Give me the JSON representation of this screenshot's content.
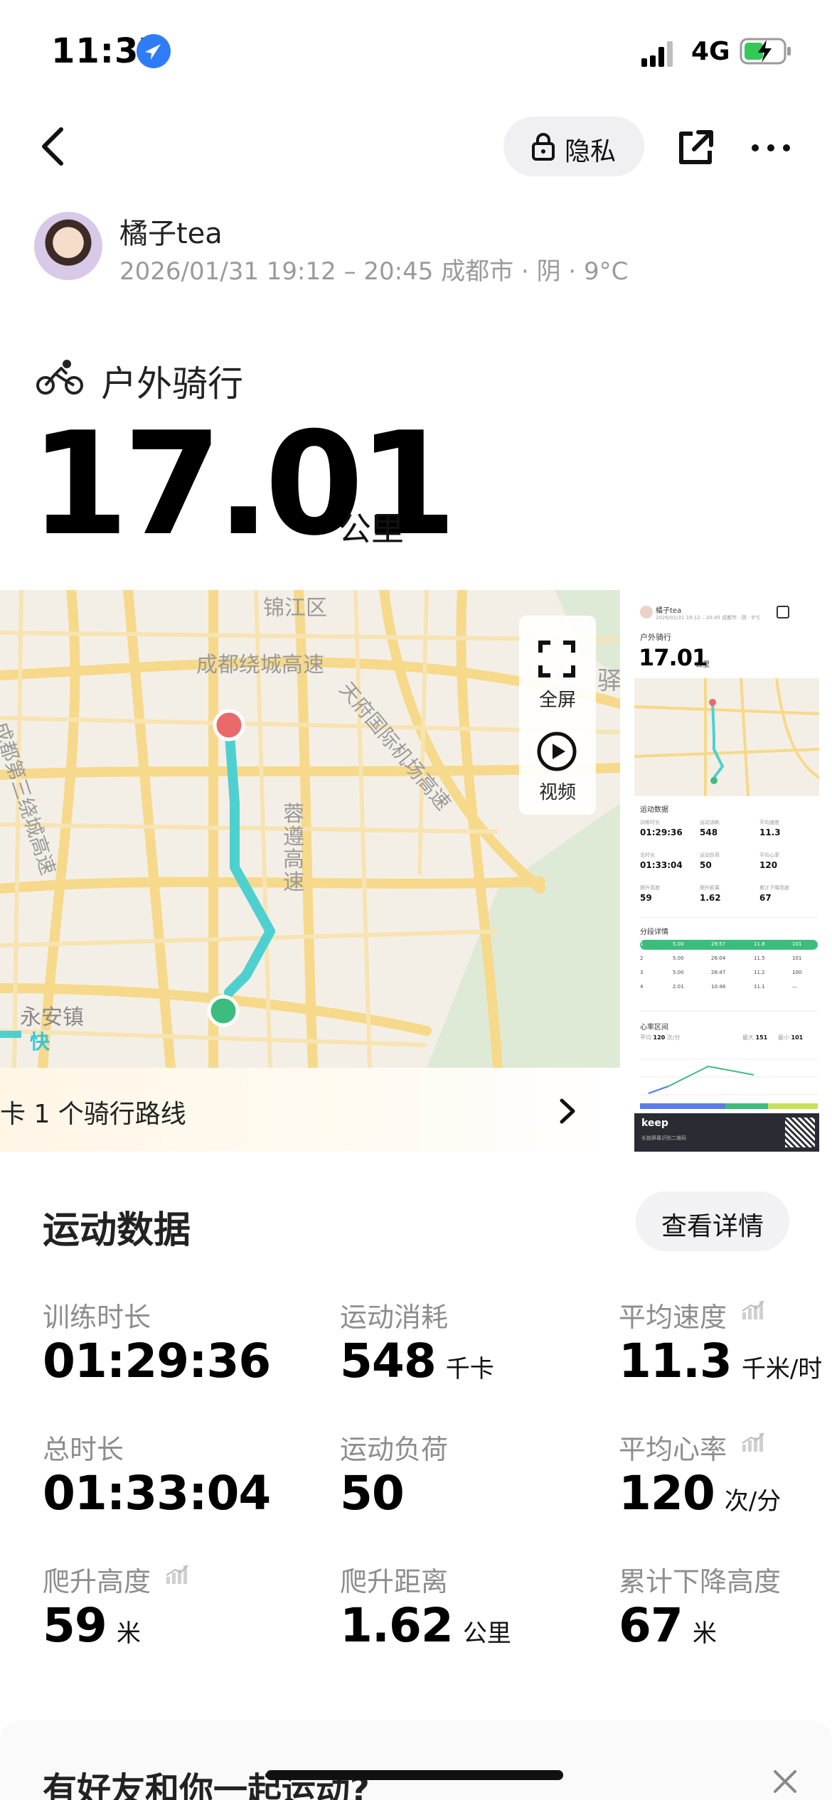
{
  "status_bar": {
    "time": "11:37",
    "network": "4G"
  },
  "nav": {
    "privacy_label": "隐私"
  },
  "user": {
    "name": "橘子tea",
    "meta": "2026/01/31 19:12 – 20:45 成都市 · 阴 · 9°C"
  },
  "activity": {
    "type": "户外骑行",
    "distance": "17.01",
    "distance_unit": "公里"
  },
  "map": {
    "labels": {
      "jinjiang": "锦江区",
      "ring_highway": "成都绕城高速",
      "third_ring": "成都第三绕城高速",
      "tianfu": "天府国际机场高速",
      "rongzun": "蓉遵高速",
      "yi": "驿",
      "town": "永安镇",
      "fast": "快"
    },
    "fullscreen_label": "全屏",
    "video_label": "视频",
    "route_banner": "卡 1 个骑行路线",
    "route_color": "#4fd0d0",
    "start_color": "#3dbd7d",
    "end_color": "#e96a6a"
  },
  "thumbnail": {
    "user": "橘子tea",
    "meta": "2026/01/31 19:12 – 20:45 成都市 · 阴 · 9°C",
    "activity": "户外骑行",
    "distance": "17.01",
    "unit": "公里",
    "section_stats": "运动数据",
    "stats": [
      {
        "label": "训练时长",
        "value": "01:29:36"
      },
      {
        "label": "运动消耗",
        "value": "548"
      },
      {
        "label": "平均速度",
        "value": "11.3"
      },
      {
        "label": "总时长",
        "value": "01:33:04"
      },
      {
        "label": "运动负荷",
        "value": "50"
      },
      {
        "label": "平均心率",
        "value": "120"
      },
      {
        "label": "爬升高度",
        "value": "59"
      },
      {
        "label": "爬升距离",
        "value": "1.62"
      },
      {
        "label": "累计下降高度",
        "value": "67"
      }
    ],
    "section_split": "分段详情",
    "split_rows": [
      [
        "1",
        "5.00",
        "29:57",
        "11.8",
        "101"
      ],
      [
        "2",
        "5.00",
        "26:04",
        "11.5",
        "101"
      ],
      [
        "3",
        "5.00",
        "26:47",
        "11.2",
        "100"
      ],
      [
        "4",
        "2.01",
        "10:48",
        "11.1",
        "—"
      ]
    ],
    "section_hr": "心率区间",
    "hr_avg": "120",
    "hr_max": "151",
    "hr_min": "101",
    "brand": "keep",
    "brand_sub": "长按屏幕识别二维码"
  },
  "stats": {
    "title": "运动数据",
    "detail_button": "查看详情",
    "items": [
      {
        "label": "训练时长",
        "value": "01:29:36",
        "unit": ""
      },
      {
        "label": "运动消耗",
        "value": "548",
        "unit": "千卡"
      },
      {
        "label": "平均速度",
        "value": "11.3",
        "unit": "千米/时"
      },
      {
        "label": "总时长",
        "value": "01:33:04",
        "unit": ""
      },
      {
        "label": "运动负荷",
        "value": "50",
        "unit": ""
      },
      {
        "label": "平均心率",
        "value": "120",
        "unit": "次/分"
      },
      {
        "label": "爬升高度",
        "value": "59",
        "unit": "米"
      },
      {
        "label": "爬升距离",
        "value": "1.62",
        "unit": "公里"
      },
      {
        "label": "累计下降高度",
        "value": "67",
        "unit": "米"
      }
    ]
  },
  "bottom": {
    "friends_text": "有好友和你一起运动?"
  }
}
